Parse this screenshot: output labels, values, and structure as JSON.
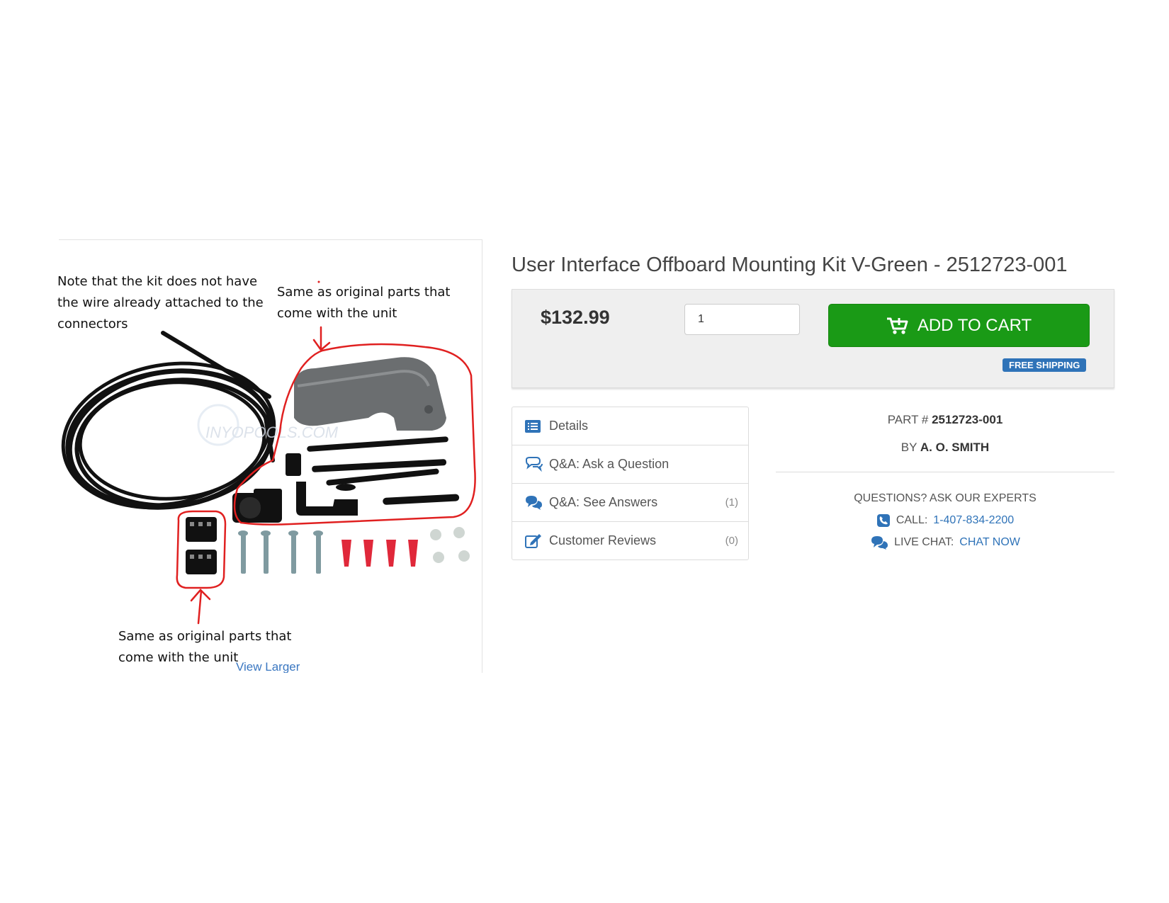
{
  "annotations": {
    "note_kit": [
      "Note that the kit does not have",
      "the wire already attached to the",
      "connectors"
    ],
    "same_top": [
      "Same as  original parts that",
      "come with the unit"
    ],
    "same_bottom": [
      "Same as  original parts that",
      "come with the unit"
    ]
  },
  "image": {
    "watermark": "INYOPOOLS.COM",
    "view_larger": "View Larger"
  },
  "product": {
    "title": "User Interface Offboard Mounting Kit V-Green - 2512723-001",
    "price": "$132.99",
    "quantity": "1",
    "add_to_cart": "ADD TO CART",
    "free_shipping": "FREE SHIPPING",
    "part_label": "PART #",
    "part_number": "2512723-001",
    "by_label": "BY",
    "brand": "A. O. SMITH"
  },
  "tabs": [
    {
      "label": "Details",
      "icon": "list-icon"
    },
    {
      "label": "Q&A: Ask a Question",
      "icon": "chat-bubble-icon"
    },
    {
      "label": "Q&A: See Answers",
      "count": "(1)",
      "icon": "chat-bubbles-icon"
    },
    {
      "label": "Customer Reviews",
      "count": "(0)",
      "icon": "edit-icon"
    }
  ],
  "experts": {
    "heading": "QUESTIONS? ASK OUR EXPERTS",
    "call_label": "CALL:",
    "phone": "1-407-834-2200",
    "chat_label": "LIVE CHAT:",
    "chat_link": "CHAT NOW"
  },
  "colors": {
    "add_to_cart_bg": "#1a9a16",
    "free_shipping_bg": "#2f73b8",
    "link": "#2f73b8",
    "annotation_red": "#e02020"
  }
}
